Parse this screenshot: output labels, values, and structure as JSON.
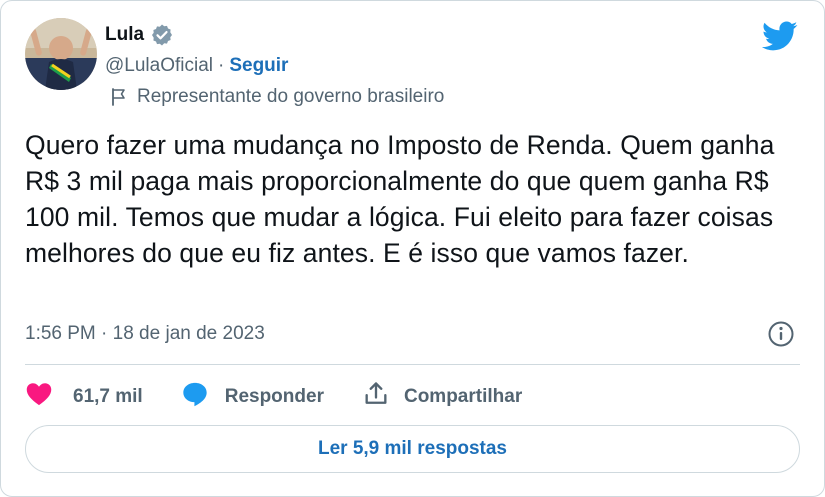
{
  "author": {
    "name": "Lula",
    "handle": "@LulaOficial",
    "separator": "·",
    "follow_label": "Seguir",
    "account_label": "Representante do governo brasileiro"
  },
  "tweet": {
    "text": "Quero fazer uma mudança no Imposto de Renda. Quem ganha R$ 3 mil paga mais proporcionalmente do que quem ganha R$ 100 mil. Temos que mudar a lógica. Fui eleito para fazer coisas melhores do que eu fiz antes. E é isso que vamos fazer.",
    "timestamp": "1:56 PM · 18 de jan de 2023"
  },
  "actions": {
    "like_count": "61,7 mil",
    "reply_label": "Responder",
    "share_label": "Compartilhar"
  },
  "more_replies_label": "Ler 5,9 mil respostas",
  "icons": {
    "verified": "verified-badge-icon",
    "flag": "flag-icon",
    "brand": "twitter-logo-icon",
    "info": "info-icon",
    "like": "heart-icon",
    "reply": "speech-bubble-icon",
    "share": "share-icon"
  },
  "colors": {
    "brand_blue": "#1d9bf0",
    "link_blue": "#1d6fb8",
    "heart": "#f91880",
    "secondary_text": "#536471",
    "border": "#cfd9de"
  }
}
